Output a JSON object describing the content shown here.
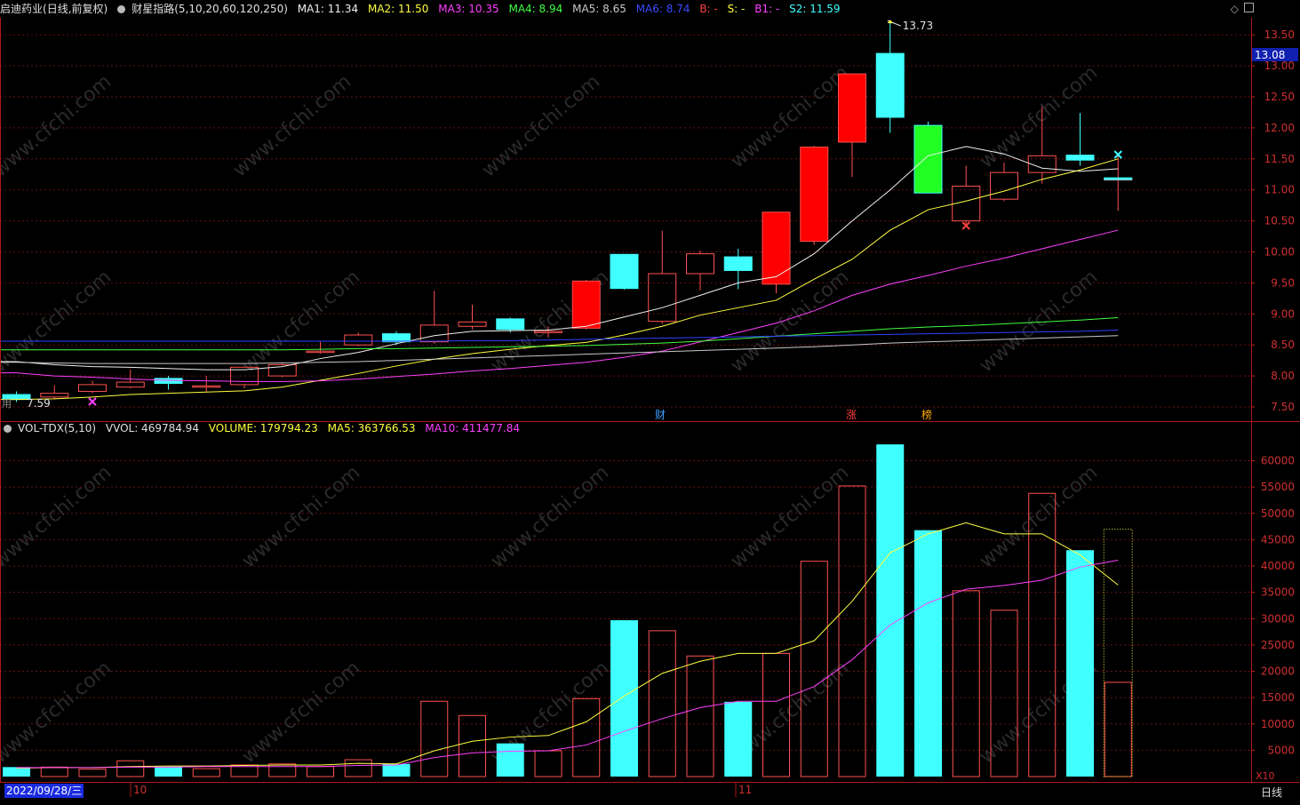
{
  "header": {
    "stock": "启迪药业",
    "period": "(日线,前复权)",
    "indicator": "财星指路(5,10,20,60,120,250)",
    "ma1": "MA1: 11.34",
    "ma2": "MA2: 11.50",
    "ma3": "MA3: 10.35",
    "ma4": "MA4: 8.94",
    "ma5": "MA5: 8.65",
    "ma6": "MA6: 8.74",
    "b": "B: -",
    "s": "S: -",
    "b1": "B1: -",
    "s2": "S2: 11.59",
    "ma1_color": "#f0f0f0",
    "ma2_color": "#ffff40",
    "ma3_color": "#ff40ff",
    "ma4_color": "#40ff40",
    "ma5_color": "#c8c8c8",
    "ma6_color": "#3040ff",
    "b_color": "#ff4040",
    "s_color": "#ffff40",
    "b1_color": "#ff40ff",
    "s2_color": "#40ffff"
  },
  "vol_header": {
    "name": "VOL-TDX(5,10)",
    "vvol": "VVOL: 469784.94",
    "volume": "VOLUME: 179794.23",
    "ma5": "MA5: 363766.53",
    "ma10": "MA10: 411477.84"
  },
  "markers": {
    "high_label": "13.73",
    "low_label": "7.59",
    "current_price": "13.08",
    "cai": "财",
    "zhang": "涨",
    "bang": "榜",
    "left_note": "用",
    "x10": "X10"
  },
  "footer": {
    "date": "2022/09/28/三",
    "month_10": "10",
    "month_11": "11",
    "period_button": "日线"
  },
  "watermark": "www.cfchi.com",
  "chart_data": [
    {
      "type": "candlestick",
      "title": "启迪药业 (日线,前复权)",
      "ylim": [
        7.3,
        13.8
      ],
      "y_ticks": [
        7.5,
        8.0,
        8.5,
        9.0,
        9.5,
        10.0,
        10.5,
        11.0,
        11.5,
        12.0,
        12.5,
        13.0,
        13.5
      ],
      "ohlc": [
        [
          7.7,
          7.75,
          7.58,
          7.62
        ],
        [
          7.66,
          7.85,
          7.62,
          7.72
        ],
        [
          7.75,
          7.92,
          7.72,
          7.86
        ],
        [
          7.82,
          8.1,
          7.8,
          7.9
        ],
        [
          7.96,
          8.0,
          7.78,
          7.88
        ],
        [
          7.82,
          8.0,
          7.74,
          7.84
        ],
        [
          7.86,
          8.15,
          7.8,
          8.14
        ],
        [
          8.0,
          8.2,
          7.98,
          8.18
        ],
        [
          8.38,
          8.55,
          8.36,
          8.4
        ],
        [
          8.5,
          8.7,
          8.48,
          8.66
        ],
        [
          8.68,
          8.72,
          8.5,
          8.55
        ],
        [
          8.55,
          9.37,
          8.52,
          8.82
        ],
        [
          8.8,
          9.15,
          8.75,
          8.87
        ],
        [
          8.92,
          8.94,
          8.7,
          8.75
        ],
        [
          8.7,
          8.8,
          8.62,
          8.72
        ],
        [
          8.77,
          9.55,
          8.75,
          9.53
        ],
        [
          9.96,
          9.96,
          9.39,
          9.41
        ],
        [
          8.88,
          10.34,
          8.84,
          9.65
        ],
        [
          9.65,
          10.02,
          9.38,
          9.97
        ],
        [
          9.92,
          10.05,
          9.4,
          9.7
        ],
        [
          9.48,
          10.64,
          9.33,
          10.64
        ],
        [
          10.17,
          11.71,
          10.11,
          11.69
        ],
        [
          11.77,
          12.88,
          11.21,
          12.87
        ],
        [
          13.2,
          13.73,
          11.92,
          12.17
        ],
        [
          12.04,
          12.1,
          10.95,
          10.95
        ],
        [
          10.5,
          11.39,
          10.44,
          11.06
        ],
        [
          10.85,
          11.44,
          10.82,
          11.28
        ],
        [
          11.28,
          12.34,
          11.1,
          11.55
        ],
        [
          11.56,
          12.24,
          11.39,
          11.48
        ],
        [
          11.18,
          11.59,
          10.66,
          11.18
        ]
      ],
      "lines": [
        {
          "name": "MA1",
          "color": "#f0f0f0",
          "values": [
            8.23,
            8.18,
            8.15,
            8.14,
            8.12,
            8.1,
            8.1,
            8.15,
            8.28,
            8.38,
            8.52,
            8.65,
            8.72,
            8.73,
            8.74,
            8.8,
            8.95,
            9.1,
            9.3,
            9.5,
            9.6,
            9.97,
            10.5,
            11.0,
            11.55,
            11.7,
            11.58,
            11.35,
            11.3,
            11.34
          ]
        },
        {
          "name": "MA2",
          "color": "#ffff40",
          "values": [
            7.62,
            7.63,
            7.66,
            7.7,
            7.72,
            7.74,
            7.76,
            7.82,
            7.93,
            8.04,
            8.16,
            8.27,
            8.36,
            8.43,
            8.49,
            8.54,
            8.66,
            8.8,
            8.98,
            9.1,
            9.22,
            9.56,
            9.88,
            10.35,
            10.68,
            10.82,
            10.98,
            11.17,
            11.32,
            11.5
          ]
        },
        {
          "name": "MA3",
          "color": "#ff40ff",
          "values": [
            8.05,
            8.0,
            7.98,
            7.95,
            7.93,
            7.92,
            7.91,
            7.91,
            7.92,
            7.95,
            7.99,
            8.03,
            8.08,
            8.12,
            8.17,
            8.22,
            8.3,
            8.4,
            8.55,
            8.7,
            8.85,
            9.05,
            9.3,
            9.48,
            9.62,
            9.77,
            9.9,
            10.05,
            10.2,
            10.35
          ]
        },
        {
          "name": "MA4",
          "color": "#40ff40",
          "values": [
            8.42,
            8.42,
            8.42,
            8.42,
            8.42,
            8.42,
            8.42,
            8.42,
            8.43,
            8.44,
            8.44,
            8.45,
            8.46,
            8.47,
            8.48,
            8.49,
            8.51,
            8.53,
            8.56,
            8.6,
            8.64,
            8.68,
            8.72,
            8.76,
            8.79,
            8.81,
            8.84,
            8.87,
            8.9,
            8.94
          ]
        },
        {
          "name": "MA5",
          "color": "#c8c8c8",
          "values": [
            8.22,
            8.21,
            8.2,
            8.2,
            8.2,
            8.2,
            8.2,
            8.21,
            8.22,
            8.23,
            8.25,
            8.27,
            8.29,
            8.31,
            8.33,
            8.35,
            8.37,
            8.39,
            8.41,
            8.43,
            8.45,
            8.47,
            8.5,
            8.53,
            8.55,
            8.57,
            8.59,
            8.61,
            8.63,
            8.65
          ]
        },
        {
          "name": "MA6",
          "color": "#3040ff",
          "values": [
            8.56,
            8.56,
            8.56,
            8.56,
            8.56,
            8.56,
            8.56,
            8.56,
            8.56,
            8.56,
            8.56,
            8.56,
            8.57,
            8.57,
            8.58,
            8.59,
            8.6,
            8.61,
            8.62,
            8.63,
            8.64,
            8.65,
            8.66,
            8.67,
            8.68,
            8.69,
            8.7,
            8.71,
            8.72,
            8.74
          ]
        }
      ]
    },
    {
      "type": "bar",
      "title": "VOL-TDX(5,10)",
      "ylim": [
        0,
        65000
      ],
      "y_ticks": [
        5000,
        10000,
        15000,
        20000,
        25000,
        30000,
        35000,
        40000,
        45000,
        50000,
        55000,
        60000
      ],
      "unit": "X10",
      "volumes": [
        1800,
        1800,
        1400,
        3000,
        1900,
        1500,
        2200,
        2400,
        1900,
        3200,
        2400,
        14300,
        11600,
        6300,
        4900,
        14800,
        29700,
        27700,
        22900,
        14200,
        23400,
        40900,
        55200,
        63100,
        46800,
        35300,
        31600,
        53800,
        43000,
        17900
      ],
      "vvol": 46978,
      "ma5": [
        1600,
        1700,
        1700,
        1900,
        2000,
        2000,
        2100,
        2200,
        2200,
        2500,
        2400,
        4900,
        6700,
        7500,
        7800,
        10400,
        15300,
        19600,
        21900,
        23400,
        23400,
        25800,
        33300,
        42500,
        46100,
        48200,
        46100,
        46100,
        42100,
        36400
      ],
      "ma10": [
        1700,
        1700,
        1700,
        1800,
        1800,
        1900,
        1900,
        1900,
        1900,
        2100,
        2200,
        3600,
        4500,
        4800,
        4900,
        6000,
        8600,
        11000,
        13100,
        14300,
        14300,
        17100,
        22200,
        28800,
        33000,
        35600,
        36300,
        37300,
        39800,
        41100
      ]
    }
  ]
}
